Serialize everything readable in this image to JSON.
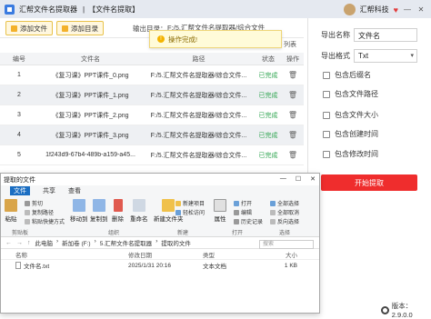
{
  "app": {
    "title": "汇帮文件名提取器",
    "separator": "|",
    "page": "【文件名提取】",
    "brand": "汇帮科技",
    "heart": "♥",
    "minimize": "—",
    "close": "✕"
  },
  "toolbar": {
    "add_file": "添加文件",
    "add_dir": "添加目录",
    "output_label": "输出目录：",
    "output_path": "F:/5.汇帮文件名提取器/综合文件"
  },
  "toast": {
    "text": "操作完成!"
  },
  "table": {
    "headers": [
      "编号",
      "文件名",
      "路径",
      "状态",
      "操作"
    ],
    "rows": [
      {
        "idx": "1",
        "name": "《复习课》PPT课件_0.png",
        "path": "F:/5.汇帮文件名提取器/综合文件...",
        "status": "已完成"
      },
      {
        "idx": "2",
        "name": "《复习课》PPT课件_1.png",
        "path": "F:/5.汇帮文件名提取器/综合文件...",
        "status": "已完成"
      },
      {
        "idx": "3",
        "name": "《复习课》PPT课件_2.png",
        "path": "F:/5.汇帮文件名提取器/综合文件...",
        "status": "已完成"
      },
      {
        "idx": "4",
        "name": "《复习课》PPT课件_3.png",
        "path": "F:/5.汇帮文件名提取器/综合文件...",
        "status": "已完成"
      },
      {
        "idx": "5",
        "name": "1f243d9-67b4-489b-a159-a45...",
        "path": "F:/5.汇帮文件名提取器/综合文件...",
        "status": "已完成"
      }
    ]
  },
  "right_panel": {
    "export_name_label": "导出名称",
    "export_name_value": "文件名",
    "export_format_label": "导出格式",
    "export_format_value": "Txt",
    "options": [
      "包含后缀名",
      "包含文件路径",
      "包含文件大小",
      "包含创建时间",
      "包含修改时间"
    ],
    "start_button": "开始提取",
    "version": "版本：2.9.0.0"
  },
  "explorer": {
    "title": "提取的文件",
    "tabs": [
      "文件",
      "共享",
      "查看"
    ],
    "ribbon": {
      "paste": "粘贴",
      "cut": "剪切",
      "copy_path": "复制路径",
      "paste_shortcut": "粘贴快捷方式",
      "clipboard_group": "剪贴板",
      "move_to": "移动到",
      "copy_to": "复制到",
      "delete": "删除",
      "rename": "重命名",
      "organize_group": "组织",
      "new_folder": "新建文件夹",
      "new_item": "新建项目",
      "easy_access": "轻松访问",
      "new_group": "新建",
      "properties": "属性",
      "open": "打开",
      "edit": "编辑",
      "history": "历史记录",
      "open_group": "打开",
      "select_all": "全部选择",
      "select_none": "全部取消",
      "invert": "反向选择",
      "select_group": "选择"
    },
    "address": [
      "此电脑",
      "新加卷 (F:)",
      "5.汇帮文件名提取器",
      "提取的文件"
    ],
    "search_placeholder": "搜索",
    "columns": [
      "名称",
      "修改日期",
      "类型",
      "大小"
    ],
    "file": {
      "name": "文件名.txt",
      "date": "2025/1/31 20:16",
      "type": "文本文档",
      "size": "1 KB"
    }
  }
}
